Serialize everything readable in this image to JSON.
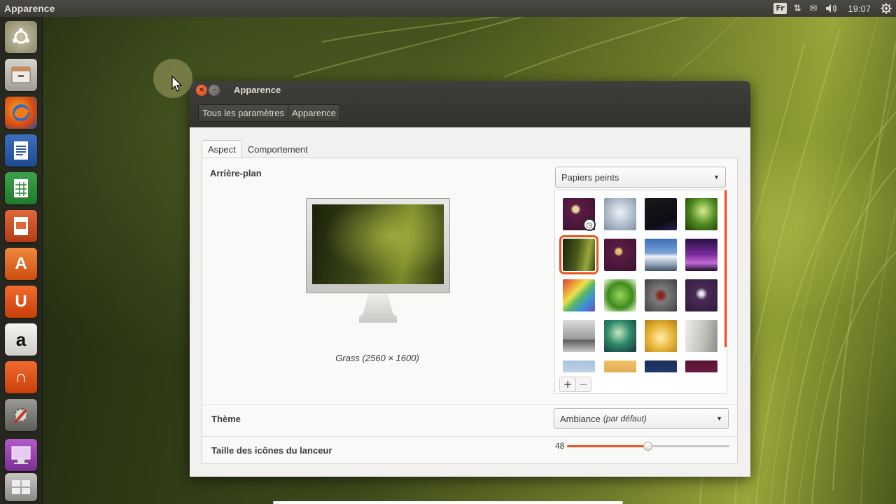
{
  "panel": {
    "app_title": "Apparence",
    "keyboard_layout": "Fr",
    "clock": "19:07",
    "indicators": [
      "keyboard-icon",
      "network-updown-icon",
      "mail-icon",
      "volume-icon",
      "gear-power-icon"
    ]
  },
  "launcher": {
    "items": [
      "ubuntu-dash-icon",
      "files-icon",
      "firefox-icon",
      "writer-icon",
      "calc-icon",
      "impress-icon",
      "software-center-icon",
      "ubuntu-one-icon",
      "amazon-icon",
      "ubuntu-one-music-icon",
      "system-settings-icon",
      "appearance-icon",
      "workspace-icon"
    ]
  },
  "window": {
    "title": "Apparence",
    "breadcrumbs": [
      "Tous les paramètres",
      "Apparence"
    ],
    "tabs": [
      "Aspect",
      "Comportement"
    ],
    "background": {
      "label": "Arrière-plan",
      "caption": "Grass (2560 × 1600)",
      "source_dropdown": "Papiers peints",
      "thumbnails": [
        "purple-clock",
        "light-blue",
        "dark-night",
        "green-leaf",
        "grass",
        "purple-cog",
        "mountains",
        "purple-sunset",
        "rainbow",
        "green-plant",
        "dark-flower",
        "purple-bird",
        "grey-sea",
        "teal-leaf",
        "yellow-field",
        "grey-grass",
        "sky",
        "dunes",
        "navy",
        "maroon"
      ],
      "selected": "grass",
      "add_label": "+",
      "remove_label": "−"
    },
    "theme": {
      "label": "Thème",
      "value": "Ambiance",
      "hint": "(par défaut)"
    },
    "icon_size": {
      "label": "Taille des icônes du lanceur",
      "value": "48",
      "fraction": 0.5
    }
  },
  "colors": {
    "accent": "#e95420",
    "panel_bg": "#3b3a36",
    "window_bg": "#f2f1f0"
  }
}
